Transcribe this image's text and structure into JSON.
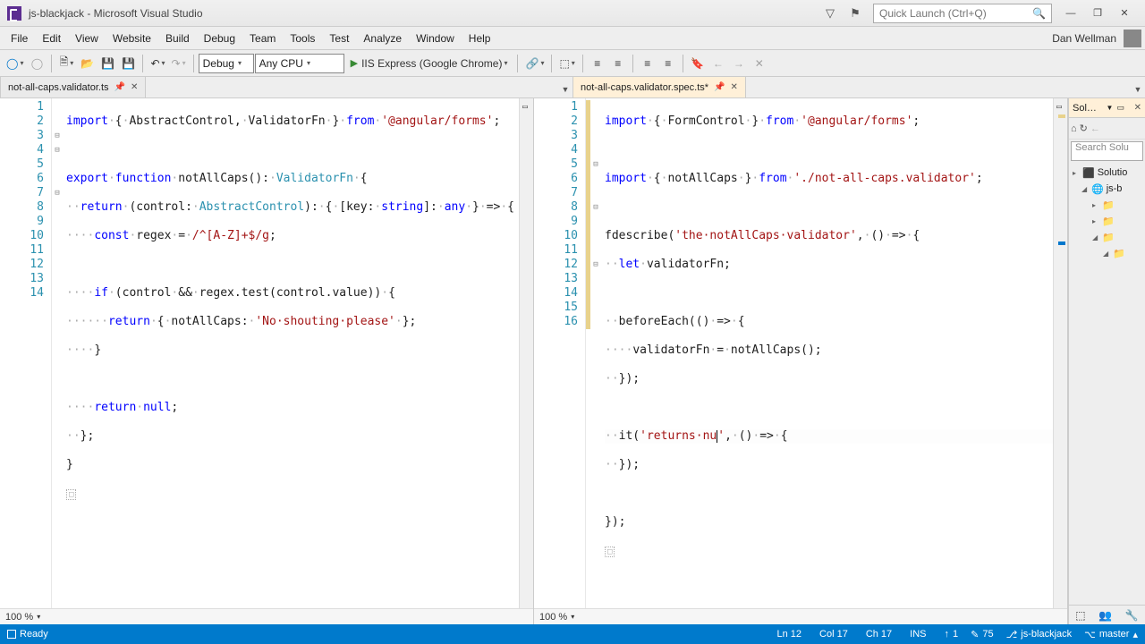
{
  "window": {
    "title": "js-blackjack - Microsoft Visual Studio"
  },
  "quicklaunch": {
    "placeholder": "Quick Launch (Ctrl+Q)"
  },
  "menu": {
    "items": [
      "File",
      "Edit",
      "View",
      "Website",
      "Build",
      "Debug",
      "Team",
      "Tools",
      "Test",
      "Analyze",
      "Window",
      "Help"
    ],
    "user": "Dan Wellman"
  },
  "toolbar": {
    "config": "Debug",
    "platform": "Any CPU",
    "run": "IIS Express (Google Chrome)"
  },
  "tabs": {
    "left": {
      "name": "not-all-caps.validator.ts"
    },
    "right": {
      "name": "not-all-caps.validator.spec.ts*"
    }
  },
  "editor_left": {
    "zoom": "100 %",
    "lines": [
      1,
      2,
      3,
      4,
      5,
      6,
      7,
      8,
      9,
      10,
      11,
      12,
      13,
      14
    ]
  },
  "editor_right": {
    "zoom": "100 %",
    "lines": [
      1,
      2,
      3,
      4,
      5,
      6,
      7,
      8,
      9,
      10,
      11,
      12,
      13,
      14,
      15,
      16
    ]
  },
  "solution": {
    "title": "Sol…",
    "search": "Search Solu",
    "root": "Solutio",
    "proj": "js-b"
  },
  "status": {
    "ready": "Ready",
    "ln": "Ln 12",
    "col": "Col 17",
    "ch": "Ch 17",
    "ins": "INS",
    "up": "1",
    "pen": "75",
    "repo": "js-blackjack",
    "branch": "master"
  }
}
